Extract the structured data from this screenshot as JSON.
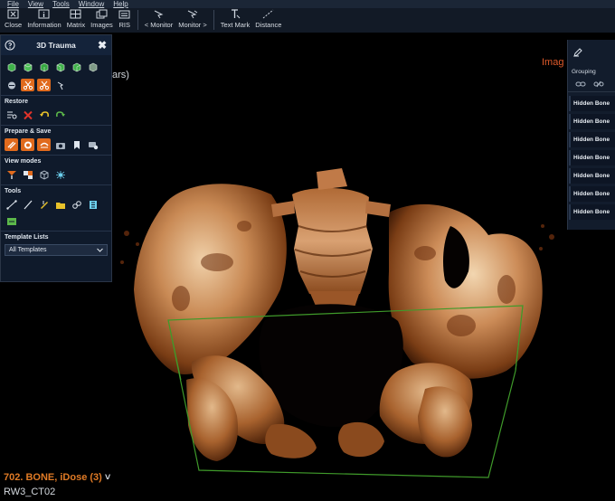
{
  "menu": [
    "File",
    "View",
    "Tools",
    "Window",
    "Help"
  ],
  "toolbar": {
    "close": "Close",
    "information": "Information",
    "matrix": "Matrix",
    "images": "Images",
    "ris": "RIS",
    "prev_monitor": "< Monitor",
    "next_monitor": "Monitor >",
    "text_mark": "Text Mark",
    "distance": "Distance"
  },
  "panel": {
    "title": "3D Trauma",
    "restore": "Restore",
    "prepare_save": "Prepare & Save",
    "view_modes": "View modes",
    "tools": "Tools",
    "template_lists": "Template Lists",
    "template_value": "All Templates"
  },
  "right_panel": {
    "grouping": "Grouping",
    "items": [
      "Hidden Bone",
      "Hidden Bone",
      "Hidden Bone",
      "Hidden Bone",
      "Hidden Bone",
      "Hidden Bone",
      "Hidden Bone"
    ]
  },
  "viewport": {
    "image_label": "Imag",
    "partial_text": "ars)",
    "series": "702. BONE, iDose (3)",
    "station": "RW3_CT02"
  },
  "colors": {
    "accent": "#e06a1d",
    "panel": "#0f1a2b",
    "series": "#e07a25",
    "bone": "#c98a55"
  }
}
